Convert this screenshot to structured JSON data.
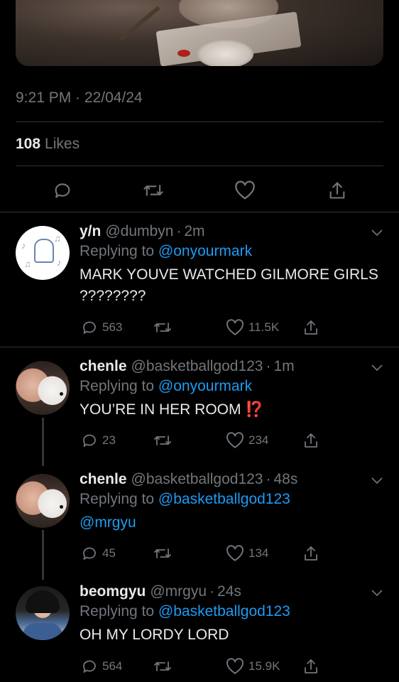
{
  "tweet_meta": {
    "time": "9:21 PM",
    "sep": " · ",
    "date": "22/04/24",
    "likes_count": "108",
    "likes_label": "Likes"
  },
  "icons": {
    "reply": "reply-icon",
    "retweet": "retweet-icon",
    "like": "heart-icon",
    "share": "share-icon",
    "more": "chevron-down-icon"
  },
  "colors": {
    "background": "#000000",
    "text": "#e7e9ea",
    "muted": "#71767b",
    "link": "#1d9bf0",
    "divider": "#2f3336",
    "alert": "#f4212e"
  },
  "replies": [
    {
      "name": "y/n",
      "handle": "@dumbyn",
      "time": "2m",
      "replying_label": "Replying to",
      "replying_to": "@onyourmark",
      "text": "MARK YOUVE WATCHED GILMORE GIRLS ????????",
      "reply_count": "563",
      "retweet_count": "",
      "like_count": "11.5K"
    },
    {
      "name": "chenle",
      "handle": "@basketballgod123",
      "time": "1m",
      "replying_label": "Replying to",
      "replying_to": "@onyourmark",
      "text": "YOU’RE IN HER ROOM",
      "emoji": "⁉️",
      "reply_count": "23",
      "retweet_count": "",
      "like_count": "234"
    },
    {
      "name": "chenle",
      "handle": "@basketballgod123",
      "time": "48s",
      "replying_label": "Replying to",
      "replying_to": "@basketballgod123",
      "text": "@mrgyu",
      "reply_count": "45",
      "retweet_count": "",
      "like_count": "134"
    },
    {
      "name": "beomgyu",
      "handle": "@mrgyu",
      "time": "24s",
      "replying_label": "Replying to",
      "replying_to": "@basketballgod123",
      "text": "OH MY LORDY LORD",
      "reply_count": "564",
      "retweet_count": "",
      "like_count": "15.9K"
    }
  ]
}
